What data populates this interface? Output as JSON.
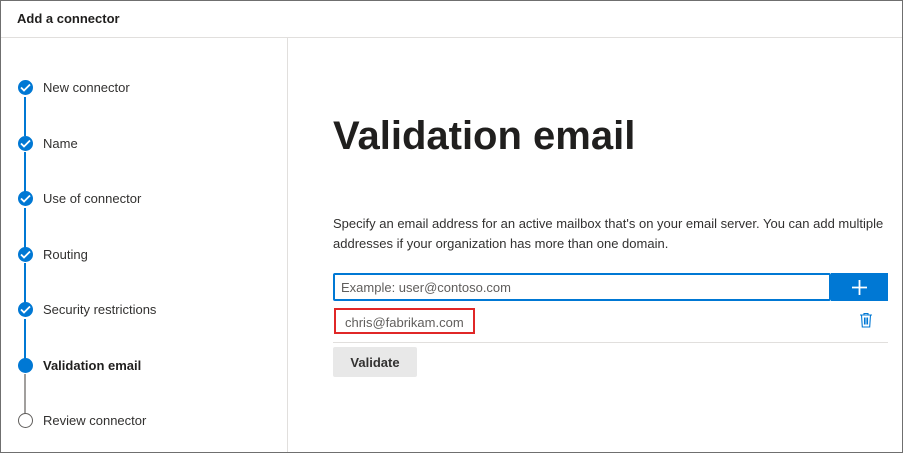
{
  "header": {
    "title": "Add a connector"
  },
  "steps": [
    {
      "label": "New connector",
      "state": "done"
    },
    {
      "label": "Name",
      "state": "done"
    },
    {
      "label": "Use of connector",
      "state": "done"
    },
    {
      "label": "Routing",
      "state": "done"
    },
    {
      "label": "Security restrictions",
      "state": "done"
    },
    {
      "label": "Validation email",
      "state": "current"
    },
    {
      "label": "Review connector",
      "state": "pending"
    }
  ],
  "main": {
    "title": "Validation email",
    "description": "Specify an email address for an active mailbox that's on your email server. You can add multiple addresses if your organization has more than one domain.",
    "email_input": {
      "placeholder": "Example: user@contoso.com",
      "value": ""
    },
    "emails": [
      "chris@fabrikam.com"
    ],
    "validate_label": "Validate"
  },
  "colors": {
    "accent": "#0078d4",
    "highlight_border": "#e02727"
  }
}
